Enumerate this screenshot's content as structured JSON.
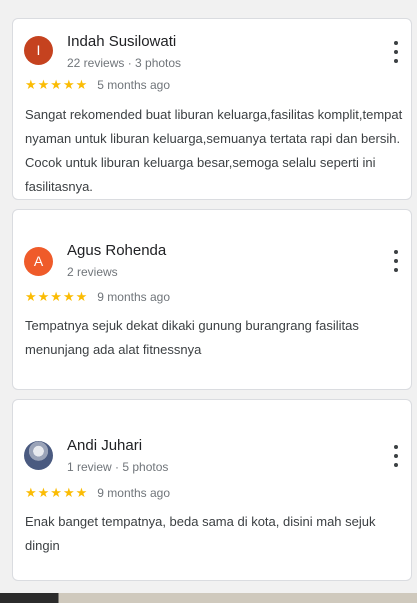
{
  "reviews": [
    {
      "avatar_letter": "I",
      "avatar_color": "#c5421f",
      "name": "Indah Susilowati",
      "meta": "22 reviews · 3 photos",
      "stars": "★★★★★",
      "time": "5 months ago",
      "text": "Sangat rekomended buat liburan keluarga,fasilitas komplit,tempat nyaman untuk liburan keluarga,semuanya tertata rapi dan bersih. Cocok untuk liburan keluarga besar,semoga selalu seperti ini fasilitasnya.",
      "rating": 5
    },
    {
      "avatar_letter": "A",
      "avatar_color": "#ef5b2a",
      "name": "Agus Rohenda",
      "meta": "2 reviews",
      "stars": "★★★★★",
      "time": "9 months ago",
      "text": "Tempatnya sejuk dekat dikaki gunung burangrang fasilitas menunjang ada alat fitnessnya",
      "rating": 5
    },
    {
      "avatar_letter": "",
      "avatar_color": "#4a5a80",
      "name": "Andi Juhari",
      "meta": "1 review · 5 photos",
      "stars": "★★★★★",
      "time": "9 months ago",
      "text": "Enak banget tempatnya, beda sama di kota, disini mah sejuk dingin",
      "rating": 5
    }
  ]
}
